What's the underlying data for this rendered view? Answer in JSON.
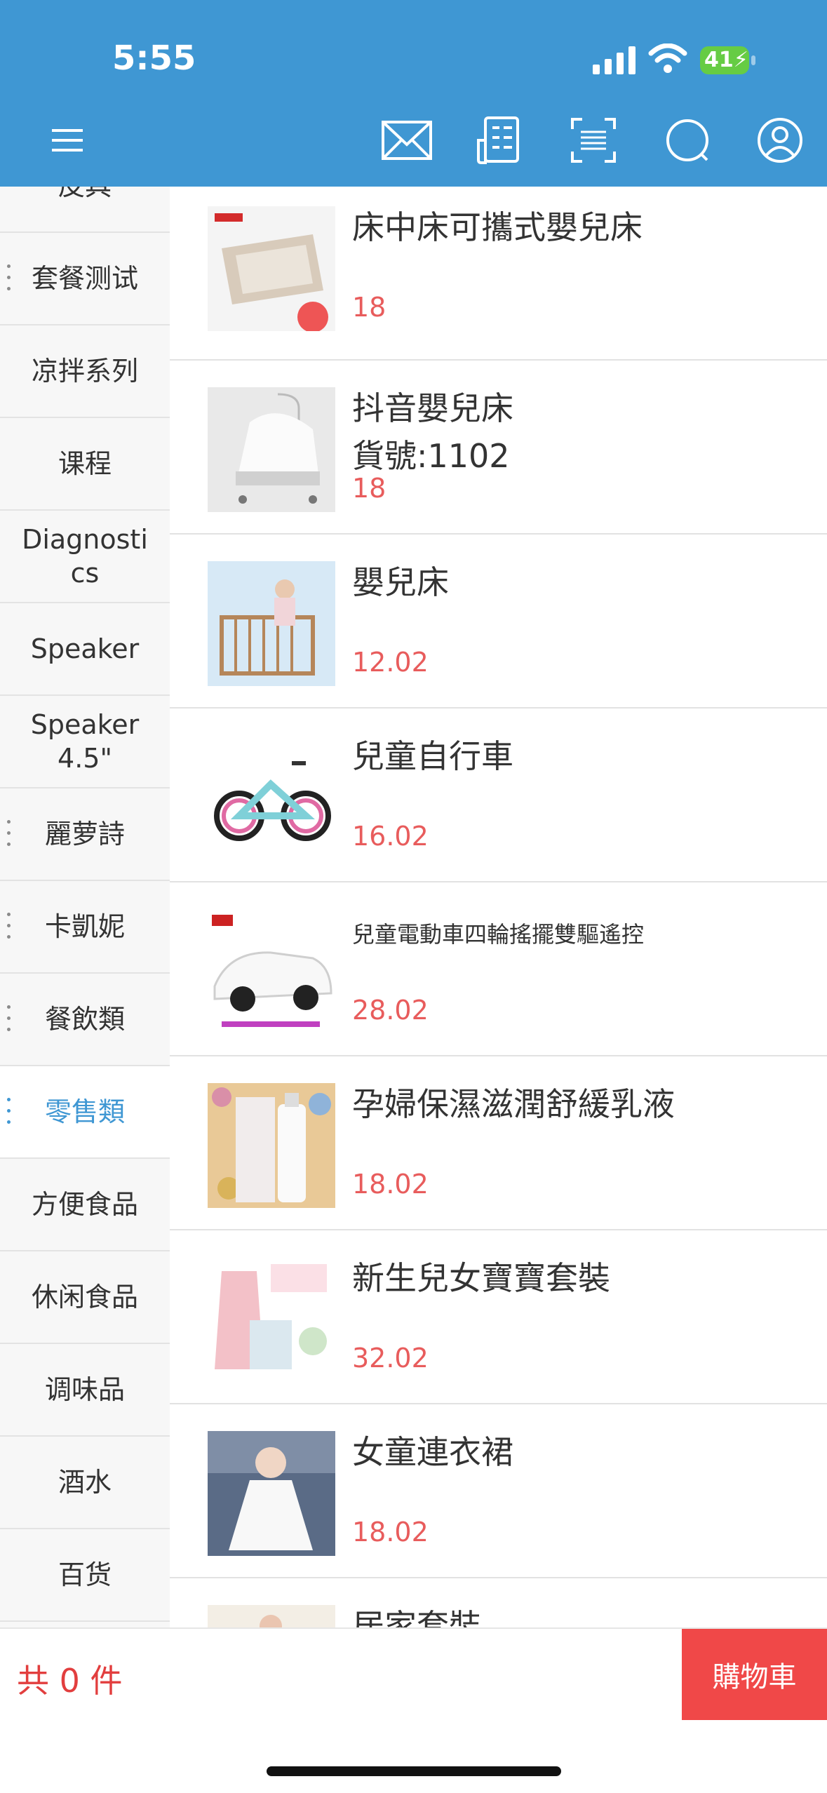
{
  "status_bar": {
    "time": "5:55",
    "battery": "41"
  },
  "header": {
    "icons": [
      "menu-icon",
      "mail-icon",
      "orders-icon",
      "scan-icon",
      "search-icon",
      "profile-icon"
    ],
    "color": "#3f97d3"
  },
  "sidebar": {
    "items": [
      {
        "label": "皮具"
      },
      {
        "label": "套餐测试"
      },
      {
        "label": "凉拌系列"
      },
      {
        "label": "课程"
      },
      {
        "label": "Diagnostics"
      },
      {
        "label": "Speaker"
      },
      {
        "label": "Speaker 4.5\""
      },
      {
        "label": "麗萝詩"
      },
      {
        "label": "卡凱妮"
      },
      {
        "label": "餐飲類"
      },
      {
        "label": "零售類"
      },
      {
        "label": "方便食品"
      },
      {
        "label": "休闲食品"
      },
      {
        "label": "调味品"
      },
      {
        "label": "酒水"
      },
      {
        "label": "百货"
      }
    ],
    "active": "零售類"
  },
  "products": [
    {
      "name": "床中床可攜式嬰兒床",
      "price": "18"
    },
    {
      "name": "抖音嬰兒床",
      "code": "貨號:1102",
      "price": "18"
    },
    {
      "name": "嬰兒床",
      "price": "12.02"
    },
    {
      "name": "兒童自行車",
      "price": "16.02"
    },
    {
      "name": "兒童電動車四輪搖擺雙驅遙控",
      "price": "28.02"
    },
    {
      "name": "孕婦保濕滋潤舒緩乳液",
      "price": "18.02"
    },
    {
      "name": "新生兒女寶寶套裝",
      "price": "32.02"
    },
    {
      "name": "女童連衣裙",
      "price": "18.02"
    },
    {
      "name": "居家套裝",
      "price": ""
    }
  ],
  "footer": {
    "count": "共 0 件",
    "cart_label": "購物車"
  },
  "colors": {
    "accent": "#3f97d3",
    "price": "#e85c5c",
    "cart": "#f04848"
  }
}
